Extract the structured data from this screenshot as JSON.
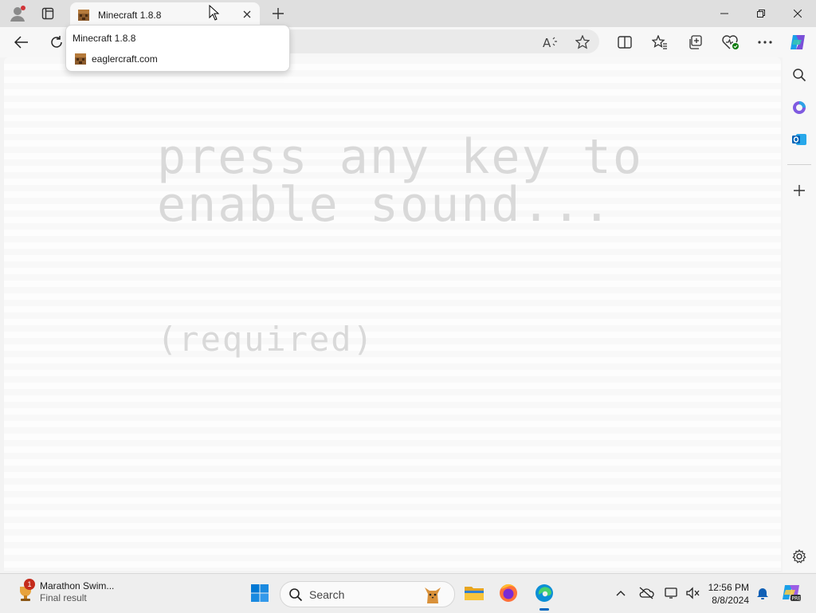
{
  "tab": {
    "title": "Minecraft 1.8.8"
  },
  "tooltip": {
    "title": "Minecraft 1.8.8",
    "domain": "eaglercraft.com"
  },
  "page": {
    "line1": "press any key to",
    "line2": "enable sound...",
    "line3": "(required)"
  },
  "taskbar": {
    "news_title": "Marathon Swim...",
    "news_subtitle": "Final result",
    "news_badge": "1",
    "search_label": "Search",
    "time": "12:56 PM",
    "date": "8/8/2024"
  },
  "icons": {
    "profile": "profile-icon",
    "tab_actions": "tab-actions-icon",
    "close": "close-icon",
    "new_tab": "plus-icon",
    "back": "back-arrow-icon",
    "refresh": "refresh-icon",
    "read_aloud": "read-aloud-icon",
    "favorite": "star-icon",
    "split": "split-screen-icon",
    "favorites": "favorites-icon",
    "collections": "collections-icon",
    "health": "browser-essentials-icon",
    "more": "more-icon",
    "copilot": "copilot-icon",
    "search": "search-icon",
    "m365": "copilot-m365-icon",
    "outlook": "outlook-icon",
    "add": "plus-icon",
    "settings": "gear-icon"
  },
  "colors": {
    "accent": "#0067c0",
    "badge": "#c42b1c",
    "game_text": "#d9d9d9"
  }
}
